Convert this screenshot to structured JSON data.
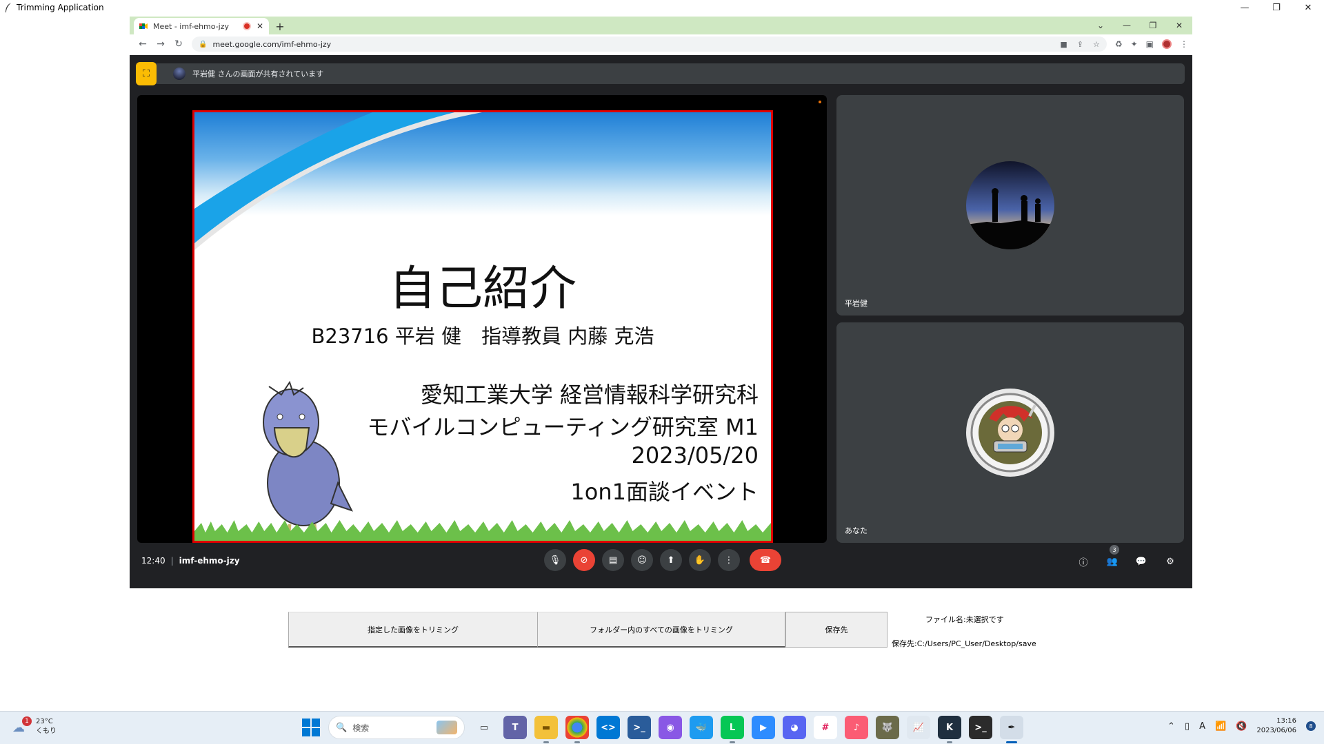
{
  "app": {
    "title": "Trimming Application"
  },
  "window_controls": {
    "minimize": "—",
    "maximize": "❐",
    "close": "✕"
  },
  "browser": {
    "tab_title": "Meet - imf-ehmo-jzy",
    "tab_close": "✕",
    "new_tab": "+",
    "url": "meet.google.com/imf-ehmo-jzy"
  },
  "meet": {
    "share_banner": "平岩健 さんの画面が共有されています",
    "slide": {
      "title": "自己紹介",
      "name_line": "B23716 平岩 健　指導教員 内藤 克浩",
      "affil_lines": [
        "愛知工業大学 経営情報科学研究科",
        "モバイルコンピューティング研究室 M1",
        "2023/05/20",
        "1on1面談イベント"
      ]
    },
    "participants": [
      {
        "name": "平岩健"
      },
      {
        "name": "あなた"
      }
    ],
    "time": "12:40",
    "separator": "|",
    "meeting_code": "imf-ehmo-jzy",
    "participant_count": "3"
  },
  "trim_app": {
    "trim_selected_label": "指定した画像をトリミング",
    "trim_folder_label": "フォルダー内のすべての画像をトリミング",
    "save_dest_label": "保存先",
    "file_name_text": "ファイル名:未選択です",
    "save_path_text": "保存先:C:/Users/PC_User/Desktop/save"
  },
  "taskbar": {
    "weather_temp": "23°C",
    "weather_cond": "くもり",
    "weather_badge": "1",
    "search_placeholder": "検索",
    "time": "13:16",
    "date": "2023/06/06",
    "notification_count": "8",
    "ime": "A"
  }
}
